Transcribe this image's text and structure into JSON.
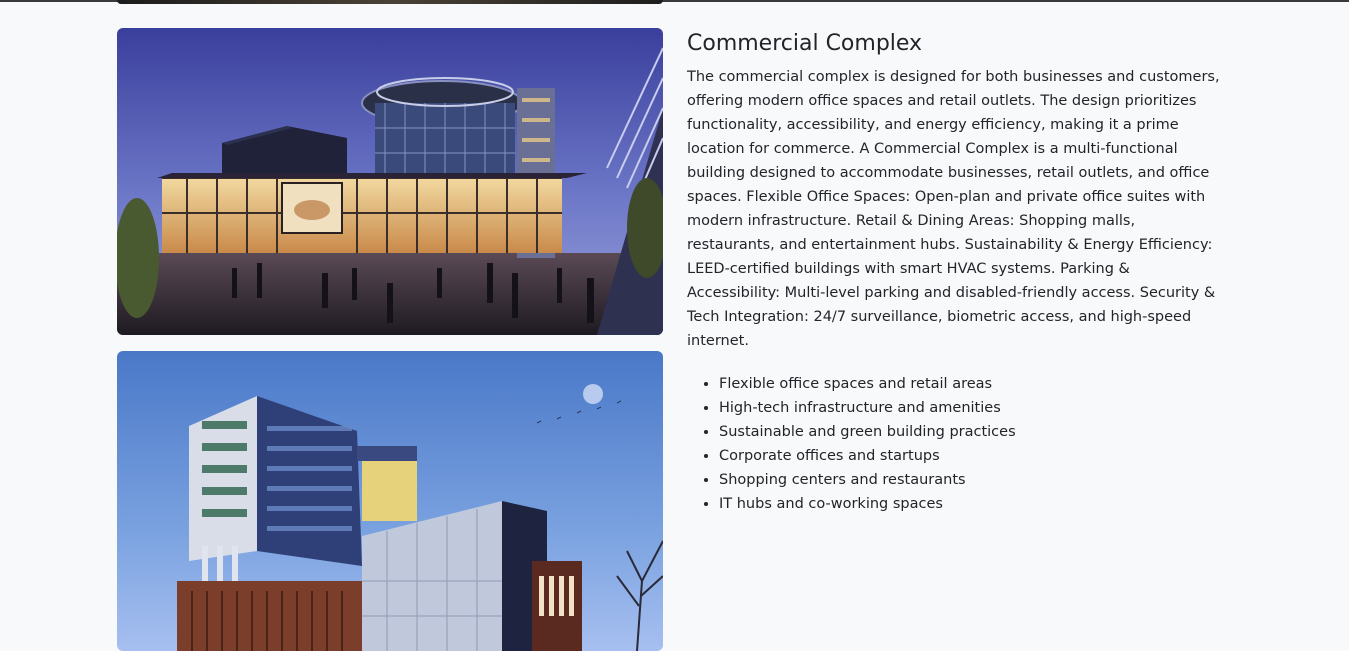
{
  "section": {
    "title": "Commercial Complex",
    "description": "The commercial complex is designed for both businesses and customers, offering modern office spaces and retail outlets. The design prioritizes functionality, accessibility, and energy efficiency, making it a prime location for commerce. A Commercial Complex is a multi-functional building designed to accommodate businesses, retail outlets, and office spaces. Flexible Office Spaces: Open-plan and private office suites with modern infrastructure. Retail & Dining Areas: Shopping malls, restaurants, and entertainment hubs. Sustainability & Energy Efficiency: LEED-certified buildings with smart HVAC systems. Parking & Accessibility: Multi-level parking and disabled-friendly access. Security & Tech Integration: 24/7 surveillance, biometric access, and high-speed internet.",
    "features": [
      "Flexible office spaces and retail areas",
      "High-tech infrastructure and amenities",
      "Sustainable and green building practices",
      "Corporate offices and startups",
      "Shopping centers and restaurants",
      "IT hubs and co-working spaces"
    ]
  },
  "images": [
    {
      "name": "commercial-complex-night-render"
    },
    {
      "name": "office-tower-dusk-render"
    }
  ]
}
